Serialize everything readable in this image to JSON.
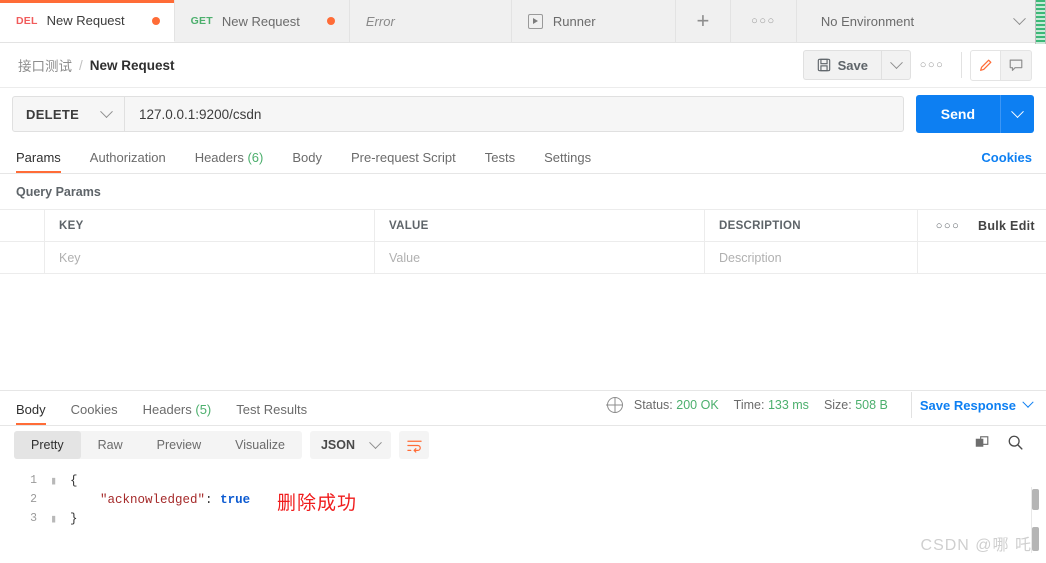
{
  "tabbar": {
    "tabs": [
      {
        "method": "DEL",
        "title": "New Request",
        "method_color": "#f15b5b",
        "active": true
      },
      {
        "method": "GET",
        "title": "New Request",
        "method_color": "#4caf6d",
        "active": false
      }
    ],
    "error_label": "Error",
    "runner_label": "Runner",
    "runner_icon": "play-icon",
    "plus_label": "+",
    "overflow_icon": "more-horizontal-icon",
    "environment": {
      "label": "No Environment",
      "caret_icon": "chevron-down-icon"
    }
  },
  "breadcrumb": {
    "folder": "接口测试",
    "separator": "/",
    "name": "New Request"
  },
  "toolbar": {
    "save_label": "Save",
    "save_icon": "floppy-disk-icon",
    "save_caret_icon": "chevron-down-icon",
    "more_icon": "more-horizontal-icon",
    "edit_icon": "pencil-icon",
    "comment_icon": "comment-icon",
    "edit_icon_color": "#ff6c37"
  },
  "request": {
    "method": "DELETE",
    "method_caret_icon": "chevron-down-icon",
    "url": "127.0.0.1:9200/csdn",
    "send_label": "Send",
    "send_caret_icon": "chevron-down-icon",
    "send_color": "#0d7ff2",
    "tabs": [
      {
        "label": "Params",
        "count": "",
        "active": true
      },
      {
        "label": "Authorization",
        "count": "",
        "active": false
      },
      {
        "label": "Headers",
        "count": "(6)",
        "active": false
      },
      {
        "label": "Body",
        "count": "",
        "active": false
      },
      {
        "label": "Pre-request Script",
        "count": "",
        "active": false
      },
      {
        "label": "Tests",
        "count": "",
        "active": false
      },
      {
        "label": "Settings",
        "count": "",
        "active": false
      }
    ],
    "cookies_label": "Cookies",
    "query_params_label": "Query Params",
    "table": {
      "headers": [
        "KEY",
        "VALUE",
        "DESCRIPTION"
      ],
      "row_more_icon": "more-horizontal-icon",
      "bulk_edit_label": "Bulk Edit",
      "placeholder_row": [
        "Key",
        "Value",
        "Description"
      ]
    }
  },
  "response": {
    "tabs": [
      {
        "label": "Body",
        "count": "",
        "active": true
      },
      {
        "label": "Cookies",
        "count": "",
        "active": false
      },
      {
        "label": "Headers",
        "count": "(5)",
        "active": false
      },
      {
        "label": "Test Results",
        "count": "",
        "active": false
      }
    ],
    "globe_icon": "globe-icon",
    "status_label": "Status:",
    "status_value": "200 OK",
    "time_label": "Time:",
    "time_value": "133 ms",
    "size_label": "Size:",
    "size_value": "508 B",
    "meta_value_color": "#4caf6d",
    "save_response_label": "Save Response",
    "save_response_caret_icon": "chevron-down-icon",
    "format_tabs": [
      {
        "label": "Pretty",
        "active": true
      },
      {
        "label": "Raw",
        "active": false
      },
      {
        "label": "Preview",
        "active": false
      },
      {
        "label": "Visualize",
        "active": false
      }
    ],
    "language": "JSON",
    "language_caret_icon": "chevron-down-icon",
    "wrap_icon": "word-wrap-icon",
    "copy_icon": "copy-icon",
    "search_icon": "search-icon",
    "body": {
      "lines": [
        {
          "num": "1",
          "text": "{"
        },
        {
          "num": "2",
          "key": "\"acknowledged\"",
          "sep": ": ",
          "value": "true"
        },
        {
          "num": "3",
          "text": "}"
        }
      ]
    },
    "annotation": "删除成功",
    "annotation_color": "#f01c1c"
  },
  "watermark": "CSDN @哪 吒"
}
